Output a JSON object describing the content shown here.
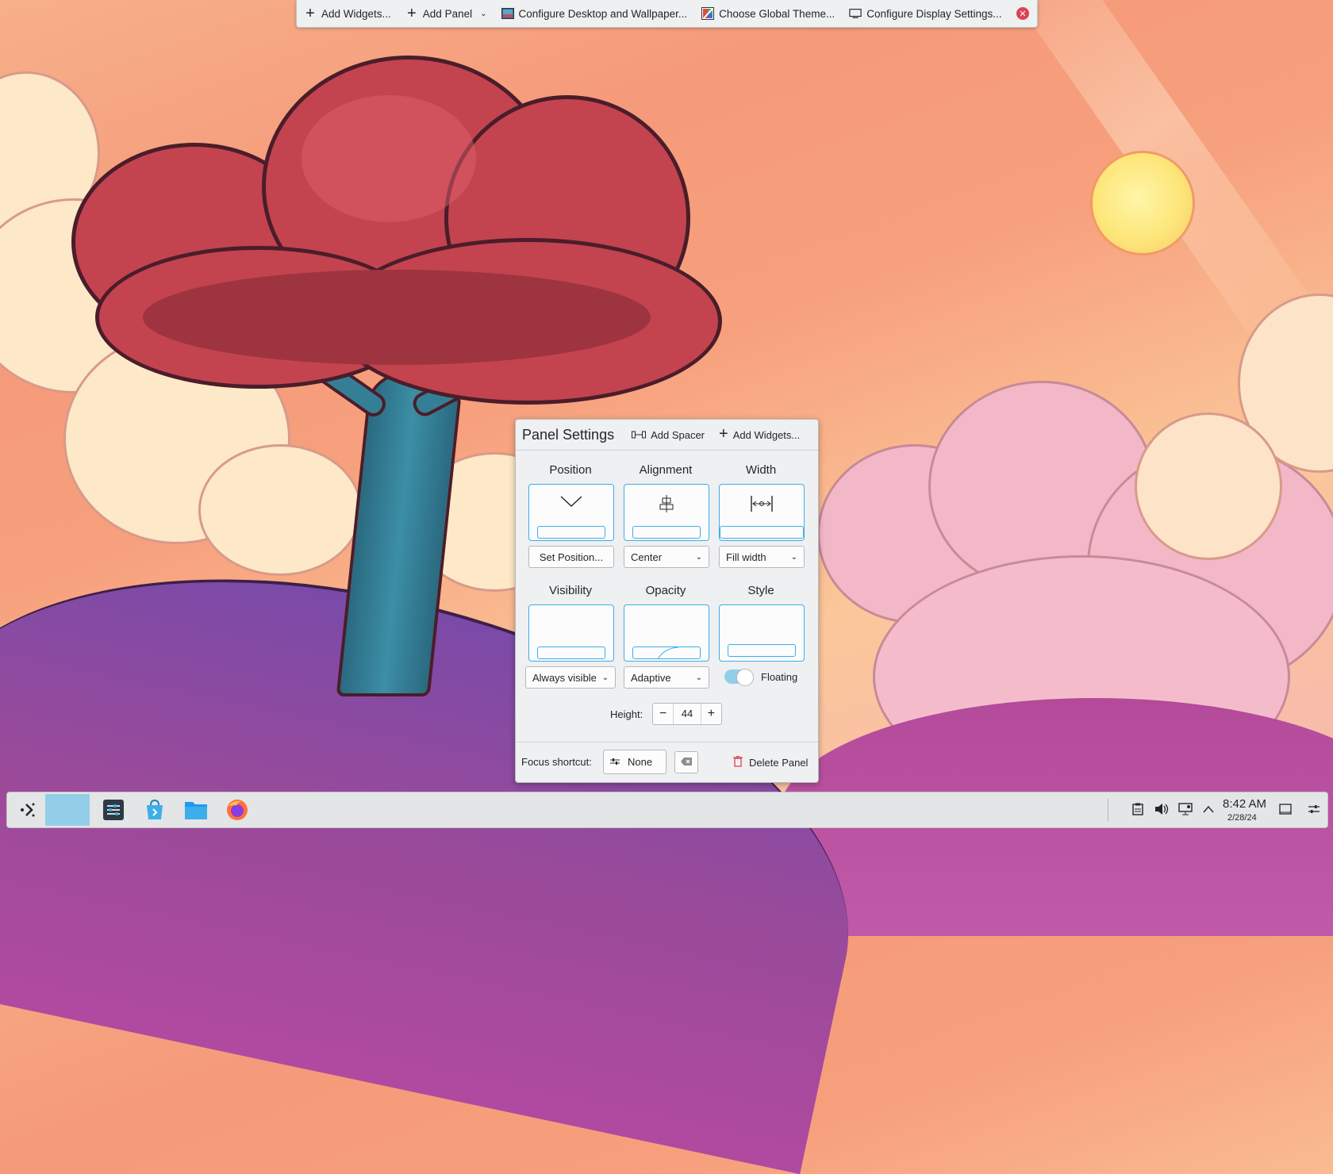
{
  "topbar": {
    "add_widgets": "Add Widgets...",
    "add_panel": "Add Panel",
    "configure_desktop": "Configure Desktop and Wallpaper...",
    "global_theme": "Choose Global Theme...",
    "display_settings": "Configure Display Settings..."
  },
  "panel_settings": {
    "title": "Panel Settings",
    "add_spacer": "Add Spacer",
    "add_widgets": "Add Widgets...",
    "position": {
      "label": "Position",
      "button": "Set Position..."
    },
    "alignment": {
      "label": "Alignment",
      "value": "Center"
    },
    "width": {
      "label": "Width",
      "value": "Fill width"
    },
    "visibility": {
      "label": "Visibility",
      "value": "Always visible"
    },
    "opacity": {
      "label": "Opacity",
      "value": "Adaptive"
    },
    "style": {
      "label": "Style",
      "floating_label": "Floating",
      "floating_on": true
    },
    "height": {
      "label": "Height:",
      "value": "44",
      "minus": "−",
      "plus": "+"
    },
    "focus_shortcut": {
      "label": "Focus shortcut:",
      "value": "None"
    },
    "delete_panel": "Delete Panel"
  },
  "taskbar": {
    "clock_time": "8:42 AM",
    "clock_date": "2/28/24"
  },
  "colors": {
    "accent": "#3daee9",
    "danger": "#da4453",
    "panel_bg": "#eff0f1"
  }
}
